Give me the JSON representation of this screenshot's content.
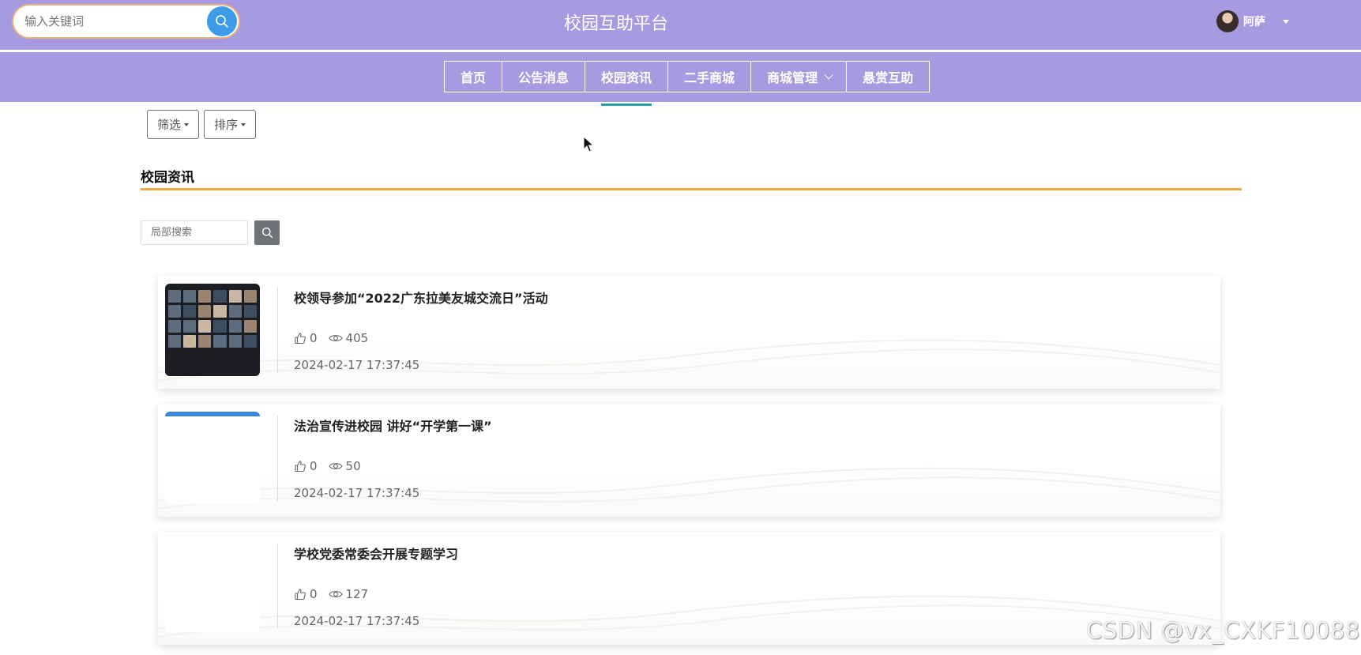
{
  "header": {
    "search_placeholder": "输入关键词",
    "site_title": "校园互助平台",
    "user_name": "阿萨"
  },
  "nav": {
    "items": [
      {
        "label": "首页"
      },
      {
        "label": "公告消息"
      },
      {
        "label": "校园资讯"
      },
      {
        "label": "二手商城"
      },
      {
        "label": "商城管理"
      },
      {
        "label": "悬赏互助"
      }
    ],
    "active": "校园资讯"
  },
  "filters": {
    "filter_label": "筛选",
    "sort_label": "排序"
  },
  "section": {
    "title": "校园资讯",
    "local_search_placeholder": "局部搜索"
  },
  "news": [
    {
      "title": "校领导参加“2022广东拉美友城交流日”活动",
      "likes": "0",
      "views": "405",
      "date": "2024-02-17 17:37:45"
    },
    {
      "title": "法治宣传进校园 讲好“开学第一课”",
      "likes": "0",
      "views": "50",
      "date": "2024-02-17 17:37:45"
    },
    {
      "title": "学校党委常委会开展专题学习",
      "likes": "0",
      "views": "127",
      "date": "2024-02-17 17:37:45"
    }
  ],
  "watermark": "CSDN @vx_CXKF10088",
  "colors": {
    "header_bg": "#a89ae0",
    "search_border": "#e6b27d",
    "search_button": "#3d9be9",
    "section_underline": "#e9a940",
    "active_tab_indicator": "#26a0a5"
  }
}
